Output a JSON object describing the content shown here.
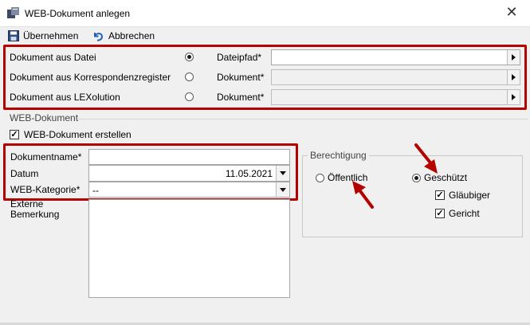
{
  "window": {
    "title": "WEB-Dokument anlegen",
    "close_glyph": "✕"
  },
  "toolbar": {
    "accept_label": "Übernehmen",
    "cancel_label": "Abbrechen"
  },
  "source": {
    "rows": [
      {
        "label": "Dokument aus Datei",
        "field_label": "Dateipfad*",
        "selected": true
      },
      {
        "label": "Dokument aus Korrespondenzregister",
        "field_label": "Dokument*",
        "selected": false
      },
      {
        "label": "Dokument aus LEXolution",
        "field_label": "Dokument*",
        "selected": false
      }
    ]
  },
  "web": {
    "section_title": "WEB-Dokument",
    "create_label": "WEB-Dokument erstellen",
    "create_checked": true,
    "name_label": "Dokumentname*",
    "name_value": "",
    "date_label": "Datum",
    "date_value": "11.05.2021",
    "category_label": "WEB-Kategorie*",
    "category_value": "--",
    "remark_label_1": "Externe",
    "remark_label_2": "Bemerkung"
  },
  "permission": {
    "title": "Berechtigung",
    "public_label": "Öffentlich",
    "public_selected": false,
    "protected_label": "Geschützt",
    "protected_selected": true,
    "creditor_label": "Gläubiger",
    "creditor_checked": true,
    "court_label": "Gericht",
    "court_checked": true
  },
  "colors": {
    "highlight": "#b50000",
    "background": "#f0f0f0"
  },
  "icons": {
    "app": "document-icon",
    "accept": "save-icon",
    "cancel": "undo-icon"
  }
}
